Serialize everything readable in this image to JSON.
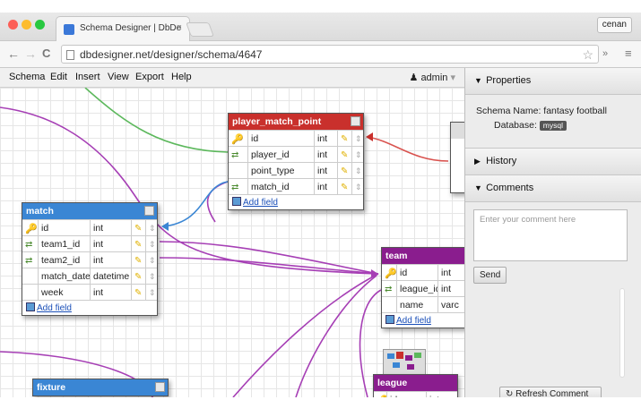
{
  "browser": {
    "tab_title": "Schema Designer | DbDe",
    "tab_close": "×",
    "profile": "cenan",
    "url": "dbdesigner.net/designer/schema/4647",
    "back": "←",
    "forward": "→",
    "reload": "C",
    "star": "☆",
    "ext_more": "»",
    "menu": "≡"
  },
  "menu": {
    "items": [
      "Schema",
      "Edit",
      "Insert",
      "View",
      "Export",
      "Help"
    ],
    "user": "admin",
    "user_caret": "▾",
    "user_icon": "user-icon"
  },
  "add_field_label": "Add field",
  "tables": {
    "player_match_point": {
      "name": "player_match_point",
      "color": "#c9302c",
      "fields": [
        {
          "name": "id",
          "type": "int",
          "icon": "key"
        },
        {
          "name": "player_id",
          "type": "int",
          "icon": "fk"
        },
        {
          "name": "point_type",
          "type": "int",
          "icon": ""
        },
        {
          "name": "match_id",
          "type": "int",
          "icon": "fk"
        }
      ]
    },
    "match": {
      "name": "match",
      "color": "#3a86d4",
      "fields": [
        {
          "name": "id",
          "type": "int",
          "icon": "key"
        },
        {
          "name": "team1_id",
          "type": "int",
          "icon": "fk"
        },
        {
          "name": "team2_id",
          "type": "int",
          "icon": "fk"
        },
        {
          "name": "match_date",
          "type": "datetime",
          "icon": ""
        },
        {
          "name": "week",
          "type": "int",
          "icon": ""
        }
      ]
    },
    "team": {
      "name": "team",
      "color": "#8a1d8e",
      "fields": [
        {
          "name": "id",
          "type": "int",
          "icon": "key"
        },
        {
          "name": "league_id",
          "type": "int",
          "icon": "fk"
        },
        {
          "name": "name",
          "type": "varc",
          "icon": ""
        }
      ]
    },
    "fixture": {
      "name": "fixture",
      "color": "#3a86d4"
    },
    "league": {
      "name": "league",
      "color": "#8a1d8e",
      "fields": [
        {
          "name": "id",
          "type": "int"
        }
      ]
    }
  },
  "panel": {
    "properties_title": "Properties",
    "schema_name_label": "Schema Name:",
    "schema_name": "fantasy football",
    "database_label": "Database:",
    "database": "mysql",
    "history_title": "History",
    "comments_title": "Comments",
    "comment_placeholder": "Enter your comment here",
    "send_label": "Send",
    "refresh_label": "Refresh Comment List"
  },
  "colors": {
    "link_purple": "#a63fb5",
    "link_green": "#5cb85c",
    "link_blue": "#3a86d4",
    "link_red": "#d9534f"
  }
}
